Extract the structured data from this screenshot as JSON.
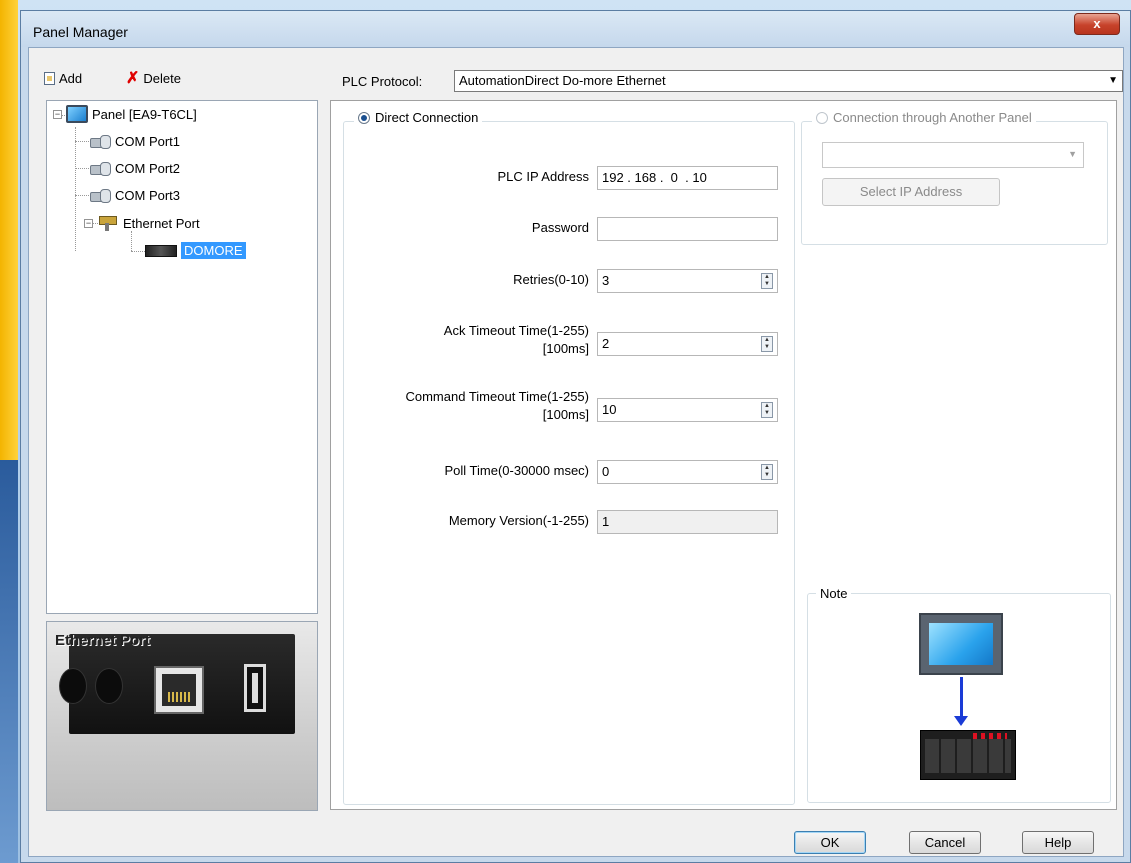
{
  "window": {
    "title": "Panel Manager",
    "close_glyph": "x"
  },
  "toolbar": {
    "add_label": "Add",
    "delete_label": "Delete"
  },
  "protocol": {
    "label": "PLC Protocol:",
    "value": "AutomationDirect Do-more Ethernet"
  },
  "tree": {
    "root": "Panel [EA9-T6CL]",
    "com1": "COM Port1",
    "com2": "COM Port2",
    "com3": "COM Port3",
    "ethernet": "Ethernet Port",
    "device": "DOMORE"
  },
  "port_image": {
    "title": "Ethernet Port"
  },
  "direct": {
    "label": "Direct Connection",
    "ip_label": "PLC IP Address",
    "ip_value": "192 . 168 .  0  . 10",
    "password_label": "Password",
    "password_value": "",
    "retries_label": "Retries(0-10)",
    "retries_value": "3",
    "ack_label_1": "Ack Timeout Time(1-255)",
    "ack_label_2": "[100ms]",
    "ack_value": "2",
    "cmd_label_1": "Command Timeout Time(1-255)",
    "cmd_label_2": "[100ms]",
    "cmd_value": "10",
    "poll_label": "Poll Time(0-30000 msec)",
    "poll_value": "0",
    "mem_label": "Memory Version(-1-255)",
    "mem_value": "1"
  },
  "another": {
    "label": "Connection through Another Panel",
    "select_ip_label": "Select IP Address"
  },
  "note": {
    "label": "Note"
  },
  "buttons": {
    "ok": "OK",
    "cancel": "Cancel",
    "help": "Help"
  }
}
